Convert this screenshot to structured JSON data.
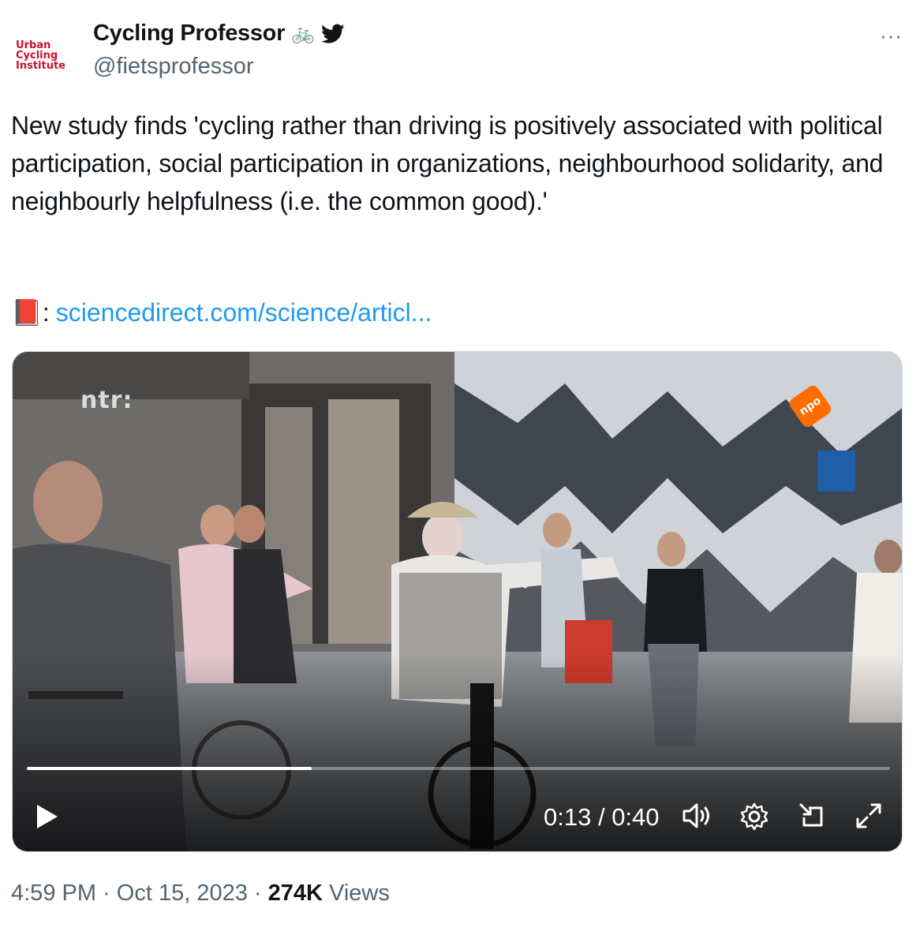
{
  "author": {
    "avatar_lines": [
      "Urban",
      "Cycling",
      "Institute"
    ],
    "display_name": "Cycling Professor",
    "handle": "@fietsprofessor",
    "emoji": "🚲"
  },
  "tweet": {
    "text": "New study finds 'cycling rather than driving is positively associated with political participation, social participation in organizations, neighbourhood solidarity, and neighbourly helpfulness (i.e. the common good).'",
    "link_prefix": "📕:",
    "link_text": "sciencedirect.com/science/articl..."
  },
  "video": {
    "watermark": "ntr:",
    "channel_logo": "npo",
    "current_time": "0:13",
    "separator": " / ",
    "duration": "0:40",
    "progress_fraction": 0.33
  },
  "footer": {
    "time": "4:59 PM",
    "dot1": " · ",
    "date": "Oct 15, 2023",
    "dot2": " · ",
    "views_count": "274K",
    "views_label": " Views"
  },
  "colors": {
    "link": "#1d9bf0",
    "secondary_text": "#536471",
    "brand_red": "#c8102e",
    "npo_orange": "#ff6d00"
  }
}
